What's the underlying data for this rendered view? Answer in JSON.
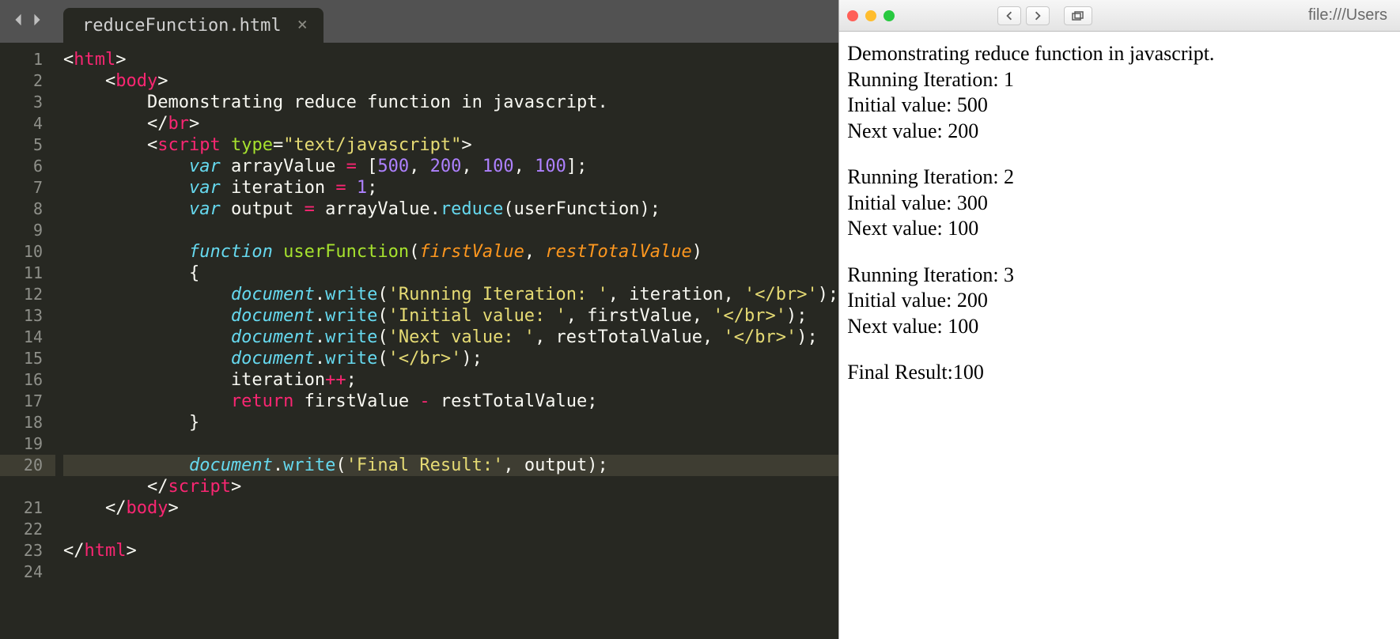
{
  "editor": {
    "tab_name": "reduceFunction.html",
    "close_glyph": "×",
    "line_count": 24,
    "highlight_line": 20,
    "code_lines": {
      "l1": {
        "indent": 0,
        "tokens": [
          {
            "c": "punct",
            "t": "<"
          },
          {
            "c": "tag",
            "t": "html"
          },
          {
            "c": "punct",
            "t": ">"
          }
        ]
      },
      "l2": {
        "indent": 1,
        "tokens": [
          {
            "c": "punct",
            "t": "<"
          },
          {
            "c": "tag",
            "t": "body"
          },
          {
            "c": "punct",
            "t": ">"
          }
        ]
      },
      "l3": {
        "indent": 2,
        "tokens": [
          {
            "c": "punct",
            "t": "Demonstrating reduce function in javascript."
          }
        ]
      },
      "l4": {
        "indent": 2,
        "tokens": [
          {
            "c": "punct",
            "t": "</"
          },
          {
            "c": "tag",
            "t": "br"
          },
          {
            "c": "punct",
            "t": ">"
          }
        ]
      },
      "l5": {
        "indent": 2,
        "tokens": [
          {
            "c": "punct",
            "t": "<"
          },
          {
            "c": "tag",
            "t": "script"
          },
          {
            "c": "punct",
            "t": " "
          },
          {
            "c": "attr",
            "t": "type"
          },
          {
            "c": "punct",
            "t": "="
          },
          {
            "c": "str",
            "t": "\"text/javascript\""
          },
          {
            "c": "punct",
            "t": ">"
          }
        ]
      },
      "l6": {
        "indent": 3,
        "tokens": [
          {
            "c": "kw ital",
            "t": "var"
          },
          {
            "c": "punct",
            "t": " arrayValue "
          },
          {
            "c": "op",
            "t": "="
          },
          {
            "c": "punct",
            "t": " ["
          },
          {
            "c": "num",
            "t": "500"
          },
          {
            "c": "punct",
            "t": ", "
          },
          {
            "c": "num",
            "t": "200"
          },
          {
            "c": "punct",
            "t": ", "
          },
          {
            "c": "num",
            "t": "100"
          },
          {
            "c": "punct",
            "t": ", "
          },
          {
            "c": "num",
            "t": "100"
          },
          {
            "c": "punct",
            "t": "];"
          }
        ]
      },
      "l7": {
        "indent": 3,
        "tokens": [
          {
            "c": "kw ital",
            "t": "var"
          },
          {
            "c": "punct",
            "t": " iteration "
          },
          {
            "c": "op",
            "t": "="
          },
          {
            "c": "punct",
            "t": " "
          },
          {
            "c": "num",
            "t": "1"
          },
          {
            "c": "punct",
            "t": ";"
          }
        ]
      },
      "l8": {
        "indent": 3,
        "tokens": [
          {
            "c": "kw ital",
            "t": "var"
          },
          {
            "c": "punct",
            "t": " output "
          },
          {
            "c": "op",
            "t": "="
          },
          {
            "c": "punct",
            "t": " arrayValue."
          },
          {
            "c": "kw-n",
            "t": "reduce"
          },
          {
            "c": "punct",
            "t": "(userFunction);"
          }
        ]
      },
      "l9": {
        "indent": 0,
        "tokens": []
      },
      "l10": {
        "indent": 3,
        "tokens": [
          {
            "c": "kw ital",
            "t": "function"
          },
          {
            "c": "punct",
            "t": " "
          },
          {
            "c": "attr",
            "t": "userFunction"
          },
          {
            "c": "punct",
            "t": "("
          },
          {
            "c": "param",
            "t": "firstValue"
          },
          {
            "c": "punct",
            "t": ", "
          },
          {
            "c": "param",
            "t": "restTotalValue"
          },
          {
            "c": "punct",
            "t": ")"
          }
        ]
      },
      "l11": {
        "indent": 3,
        "tokens": [
          {
            "c": "punct",
            "t": "{"
          }
        ]
      },
      "l12": {
        "indent": 4,
        "tokens": [
          {
            "c": "obj",
            "t": "document"
          },
          {
            "c": "punct",
            "t": "."
          },
          {
            "c": "kw-n",
            "t": "write"
          },
          {
            "c": "punct",
            "t": "("
          },
          {
            "c": "str",
            "t": "'Running Iteration: '"
          },
          {
            "c": "punct",
            "t": ", iteration, "
          },
          {
            "c": "str",
            "t": "'</br>'"
          },
          {
            "c": "punct",
            "t": ");"
          }
        ]
      },
      "l13": {
        "indent": 4,
        "tokens": [
          {
            "c": "obj",
            "t": "document"
          },
          {
            "c": "punct",
            "t": "."
          },
          {
            "c": "kw-n",
            "t": "write"
          },
          {
            "c": "punct",
            "t": "("
          },
          {
            "c": "str",
            "t": "'Initial value: '"
          },
          {
            "c": "punct",
            "t": ", firstValue, "
          },
          {
            "c": "str",
            "t": "'</br>'"
          },
          {
            "c": "punct",
            "t": ");"
          }
        ]
      },
      "l14": {
        "indent": 4,
        "tokens": [
          {
            "c": "obj",
            "t": "document"
          },
          {
            "c": "punct",
            "t": "."
          },
          {
            "c": "kw-n",
            "t": "write"
          },
          {
            "c": "punct",
            "t": "("
          },
          {
            "c": "str",
            "t": "'Next value: '"
          },
          {
            "c": "punct",
            "t": ", restTotalValue, "
          },
          {
            "c": "str",
            "t": "'</br>'"
          },
          {
            "c": "punct",
            "t": ");"
          }
        ]
      },
      "l15": {
        "indent": 4,
        "tokens": [
          {
            "c": "obj",
            "t": "document"
          },
          {
            "c": "punct",
            "t": "."
          },
          {
            "c": "kw-n",
            "t": "write"
          },
          {
            "c": "punct",
            "t": "("
          },
          {
            "c": "str",
            "t": "'</br>'"
          },
          {
            "c": "punct",
            "t": ");"
          }
        ]
      },
      "l16": {
        "indent": 4,
        "tokens": [
          {
            "c": "punct",
            "t": "iteration"
          },
          {
            "c": "op",
            "t": "++"
          },
          {
            "c": "punct",
            "t": ";"
          }
        ]
      },
      "l17": {
        "indent": 4,
        "tokens": [
          {
            "c": "tag",
            "t": "return"
          },
          {
            "c": "punct",
            "t": " firstValue "
          },
          {
            "c": "op",
            "t": "-"
          },
          {
            "c": "punct",
            "t": " restTotalValue;"
          }
        ]
      },
      "l18": {
        "indent": 3,
        "tokens": [
          {
            "c": "punct",
            "t": "}"
          }
        ]
      },
      "l19": {
        "indent": 0,
        "tokens": []
      },
      "l20": {
        "indent": 3,
        "tokens": [
          {
            "c": "obj",
            "t": "document"
          },
          {
            "c": "punct",
            "t": "."
          },
          {
            "c": "kw-n",
            "t": "write"
          },
          {
            "c": "punct",
            "t": "("
          },
          {
            "c": "str",
            "t": "'Final Result:'"
          },
          {
            "c": "punct",
            "t": ", output);"
          }
        ]
      },
      "l21": {
        "indent": 2,
        "tokens": [
          {
            "c": "punct",
            "t": "</"
          },
          {
            "c": "tag",
            "t": "script"
          },
          {
            "c": "punct",
            "t": ">"
          }
        ]
      },
      "l22": {
        "indent": 1,
        "tokens": [
          {
            "c": "punct",
            "t": "</"
          },
          {
            "c": "tag",
            "t": "body"
          },
          {
            "c": "punct",
            "t": ">"
          }
        ]
      },
      "l23": {
        "indent": 0,
        "tokens": []
      },
      "l24": {
        "indent": 0,
        "tokens": [
          {
            "c": "punct",
            "t": "</"
          },
          {
            "c": "tag",
            "t": "html"
          },
          {
            "c": "punct",
            "t": ">"
          }
        ]
      }
    }
  },
  "browser": {
    "url_partial": "file:///Users",
    "output": {
      "heading": "Demonstrating reduce function in javascript.",
      "iterations": [
        {
          "iter_label": "Running Iteration: ",
          "iter": "1",
          "init_label": "Initial value: ",
          "init": "500",
          "next_label": "Next value: ",
          "next": "200"
        },
        {
          "iter_label": "Running Iteration: ",
          "iter": "2",
          "init_label": "Initial value: ",
          "init": "300",
          "next_label": "Next value: ",
          "next": "100"
        },
        {
          "iter_label": "Running Iteration: ",
          "iter": "3",
          "init_label": "Initial value: ",
          "init": "200",
          "next_label": "Next value: ",
          "next": "100"
        }
      ],
      "final_label": "Final Result:",
      "final_value": "100"
    }
  }
}
